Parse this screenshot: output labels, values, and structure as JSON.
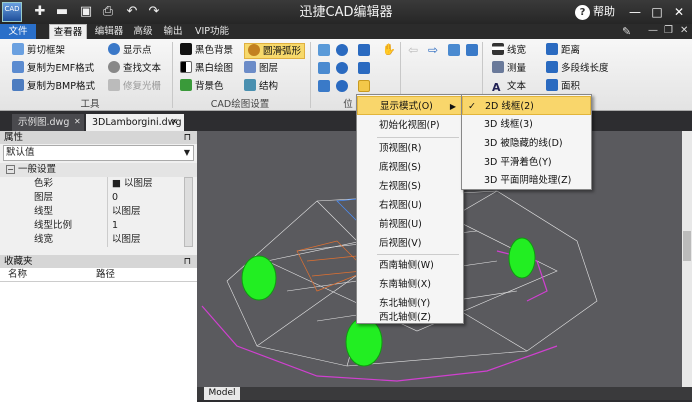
{
  "app": {
    "title": "迅捷CAD编辑器",
    "logo_text": "CAD",
    "help": "帮助"
  },
  "titlebar": {
    "icons": [
      "new-icon",
      "open-icon",
      "save-icon",
      "print-icon",
      "undo-icon",
      "redo-icon"
    ],
    "glyphs": [
      "✚",
      "▬",
      "▣",
      "⎙",
      "↶",
      "↷"
    ]
  },
  "menubar": {
    "tabs": [
      "文件",
      "查看器",
      "编辑器",
      "高级",
      "输出",
      "VIP功能"
    ]
  },
  "ribbon": {
    "tools": {
      "items": [
        "剪切框架",
        "复制为EMF格式",
        "复制为BMP格式",
        "显示点",
        "查找文本",
        "修复光栅"
      ],
      "label": "工具"
    },
    "cad": {
      "items": [
        "黑色背景",
        "黑白绘图",
        "背景色",
        "圆滑弧形",
        "图层",
        "结构"
      ],
      "label": "CAD绘图设置"
    },
    "view_label": "位",
    "measure": {
      "items": [
        "线宽",
        "测量",
        "文本",
        "距离",
        "多段线长度",
        "面积"
      ]
    }
  },
  "doc_tabs": [
    "示例图.dwg",
    "3DLamborgini.dwg"
  ],
  "properties": {
    "header": "属性",
    "dropdown": "默认值",
    "group": "一般设置",
    "rows": [
      {
        "name": "色彩",
        "value": "■ 以图层"
      },
      {
        "name": "图层",
        "value": "0"
      },
      {
        "name": "线型",
        "value": "以图层"
      },
      {
        "name": "线型比例",
        "value": "1"
      },
      {
        "name": "线宽",
        "value": "以图层"
      }
    ]
  },
  "favorites": {
    "header": "收藏夹",
    "col_name": "名称",
    "col_path": "路径"
  },
  "model_tab": "Model",
  "menu1": {
    "items": [
      "显示模式(O)",
      "初始化视图(P)",
      "顶视图(R)",
      "底视图(S)",
      "左视图(S)",
      "右视图(U)",
      "前视图(U)",
      "后视图(V)",
      "西南轴侧(W)",
      "东南轴侧(X)",
      "东北轴侧(Y)",
      "西北轴侧(Z)"
    ]
  },
  "menu2": {
    "items": [
      "2D 线框(2)",
      "3D 线框(3)",
      "3D 被隐藏的线(D)",
      "3D 平滑着色(Y)",
      "3D 平面阴暗处理(Z)"
    ],
    "checked": "✓"
  },
  "colors": {
    "accent": "#2a6fc9",
    "highlight": "#f9d66b",
    "wheel": "#22ee22",
    "wire": "#d040d0"
  }
}
